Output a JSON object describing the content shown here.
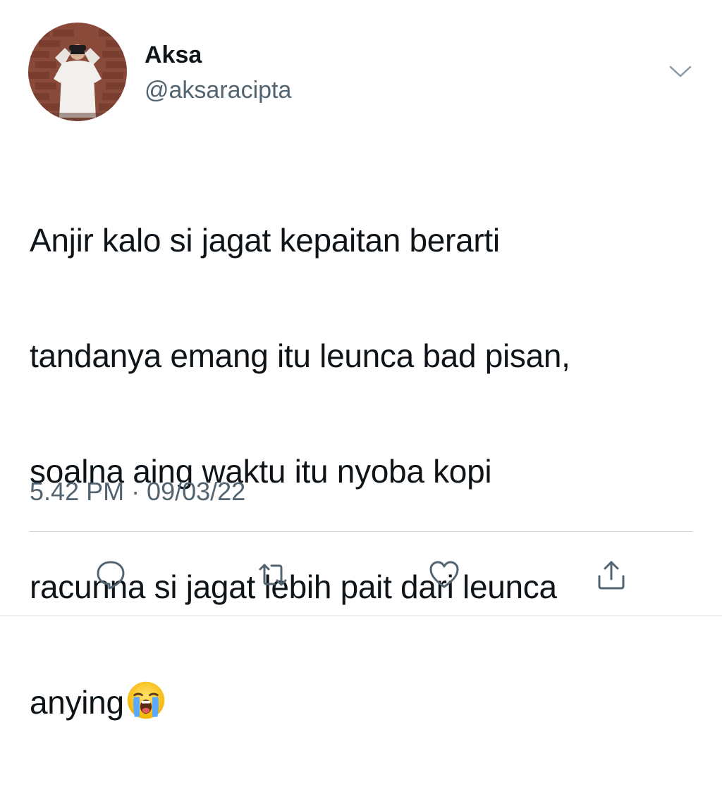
{
  "tweet": {
    "author": {
      "display_name": "Aksa",
      "handle": "@aksaracipta",
      "avatar_icon": "profile-photo"
    },
    "text_lines": [
      "Anjir kalo si jagat kepaitan berarti",
      "tandanya emang itu leunca bad pisan,",
      "soalna aing waktu itu nyoba kopi",
      "racunna si jagat lebih pait dari leunca",
      "anying"
    ],
    "emoji": "loudly-crying-face",
    "timestamp": "5.42 PM · 09/03/22"
  },
  "actions": [
    {
      "name": "reply",
      "icon": "comment-icon"
    },
    {
      "name": "retweet",
      "icon": "retweet-icon"
    },
    {
      "name": "like",
      "icon": "heart-icon"
    },
    {
      "name": "share",
      "icon": "share-icon"
    }
  ],
  "colors": {
    "text_primary": "#0f1419",
    "text_secondary": "#536471",
    "icon": "#536471",
    "divider": "#cfd9de"
  }
}
